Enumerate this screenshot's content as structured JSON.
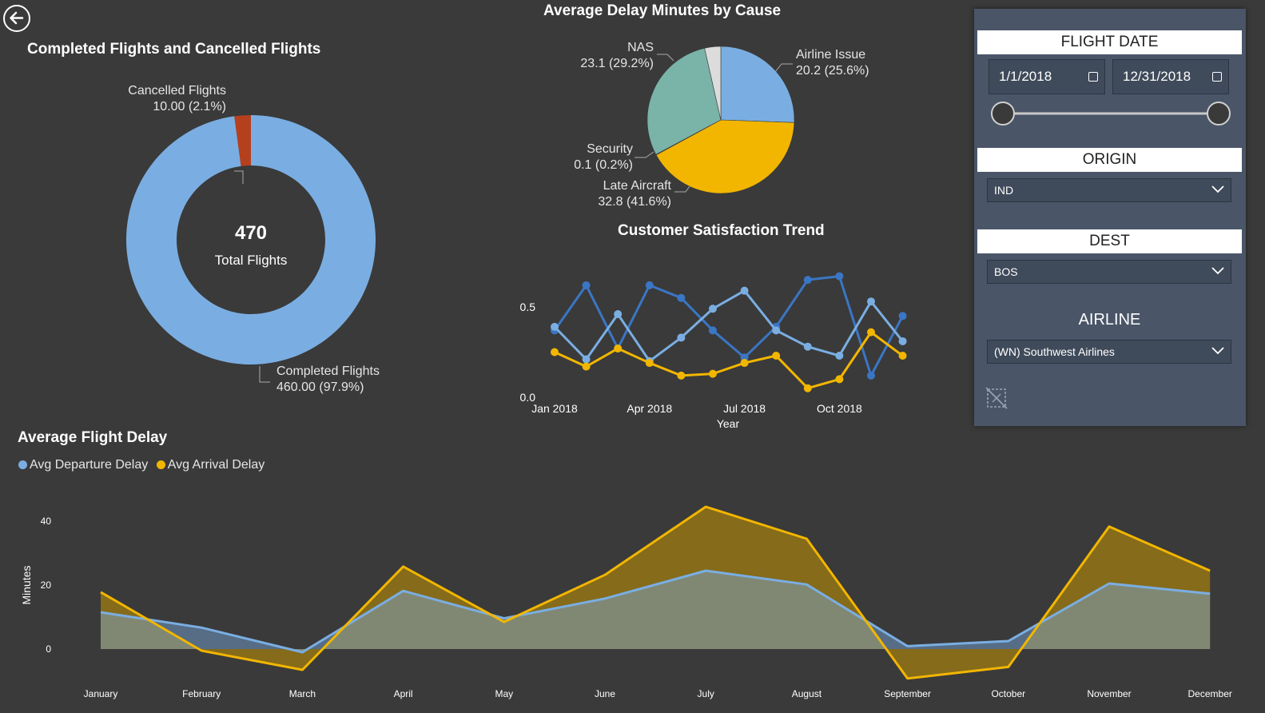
{
  "colors": {
    "background": "#3a3a3a",
    "panel": "#4a5568",
    "light_blue": "#7aaee2",
    "dark_blue": "#3a76c4",
    "yellow": "#f2b600",
    "rust": "#b5401e",
    "teal": "#7ab3a8",
    "light_gray": "#dcdcdc"
  },
  "donut": {
    "title": "Completed Flights and Cancelled Flights",
    "center_value": "470",
    "center_label": "Total Flights",
    "label_cancelled_name": "Cancelled Flights",
    "label_cancelled_value": "10.00 (2.1%)",
    "label_completed_name": "Completed Flights",
    "label_completed_value": "460.00 (97.9%)"
  },
  "pie": {
    "title": "Average Delay Minutes by Cause",
    "label_nas_name": "NAS",
    "label_nas_value": "23.1 (29.2%)",
    "label_airline_name": "Airline Issue",
    "label_airline_value": "20.2 (25.6%)",
    "label_security_name": "Security",
    "label_security_value": "0.1 (0.2%)",
    "label_late_name": "Late Aircraft",
    "label_late_value": "32.8 (41.6%)"
  },
  "satisfaction": {
    "title": "Customer Satisfaction Trend",
    "xlabel": "Year"
  },
  "delay": {
    "title": "Average Flight Delay",
    "ylabel": "Minutes",
    "legend_departure": "Avg Departure Delay",
    "legend_arrival": "Avg Arrival Delay"
  },
  "filters": {
    "flight_date_title": "FLIGHT DATE",
    "date_start": "1/1/2018",
    "date_end": "12/31/2018",
    "origin_title": "ORIGIN",
    "origin_value": "IND",
    "dest_title": "DEST",
    "dest_value": "BOS",
    "airline_title": "AIRLINE",
    "airline_value": "(WN) Southwest Airlines"
  },
  "chart_data": [
    {
      "type": "pie",
      "subtype": "donut",
      "title": "Completed Flights and Cancelled Flights",
      "categories": [
        "Completed Flights",
        "Cancelled Flights"
      ],
      "values": [
        460,
        10
      ],
      "colors": [
        "#7aaee2",
        "#b5401e"
      ]
    },
    {
      "type": "pie",
      "title": "Average Delay Minutes by Cause",
      "categories": [
        "Airline Issue",
        "Late Aircraft",
        "Security",
        "NAS",
        ""
      ],
      "values": [
        20.2,
        32.8,
        0.1,
        23.1,
        2.8
      ],
      "colors": [
        "#7aaee2",
        "#f2b600",
        "#3f6f8f",
        "#7ab3a8",
        "#dcdcdc"
      ]
    },
    {
      "type": "line",
      "title": "Customer Satisfaction Trend",
      "xlabel": "Year",
      "ylabel": "",
      "x_ticks": [
        "Jan 2018",
        "Apr 2018",
        "Jul 2018",
        "Oct 2018"
      ],
      "y_ticks": [
        0.0,
        0.5
      ],
      "ylim": [
        0,
        0.68
      ],
      "x": [
        "2018-01-01",
        "2018-01-15",
        "2018-02-01",
        "2018-02-15",
        "2018-03-01",
        "2018-03-15",
        "2018-04-01",
        "2018-04-15",
        "2018-05-01",
        "2018-05-15",
        "2018-06-01",
        "2018-06-15",
        "2018-07-01",
        "2018-07-15",
        "2018-08-01",
        "2018-08-15",
        "2018-09-01",
        "2018-09-15",
        "2018-10-01",
        "2018-10-15",
        "2018-11-01",
        "2018-11-15"
      ],
      "series": [
        {
          "color": "#3a76c4",
          "values": [
            0.37,
            null,
            0.62,
            null,
            0.27,
            null,
            0.62,
            null,
            0.55,
            null,
            0.37,
            null,
            0.22,
            null,
            0.39,
            null,
            0.65,
            null,
            0.67,
            null,
            0.12,
            null,
            0.45
          ]
        },
        {
          "color": "#7aaee2",
          "values": [
            0.39,
            null,
            0.21,
            null,
            0.46,
            null,
            0.2,
            null,
            0.33,
            null,
            0.49,
            null,
            0.59,
            null,
            0.37,
            null,
            0.28,
            null,
            0.23,
            null,
            0.53,
            null,
            0.31
          ]
        },
        {
          "color": "#f2b600",
          "values": [
            0.25,
            null,
            0.17,
            null,
            0.27,
            null,
            0.19,
            null,
            0.12,
            null,
            0.13,
            null,
            0.19,
            null,
            0.23,
            null,
            0.05,
            null,
            0.1,
            null,
            0.36,
            null,
            0.23
          ]
        }
      ]
    },
    {
      "type": "area",
      "title": "Average Flight Delay",
      "xlabel": "",
      "ylabel": "Minutes",
      "categories": [
        "January",
        "February",
        "March",
        "April",
        "May",
        "June",
        "July",
        "August",
        "September",
        "October",
        "November",
        "December"
      ],
      "y_ticks": [
        0,
        20,
        40
      ],
      "ylim": [
        -14,
        46
      ],
      "series": [
        {
          "name": "Avg Departure Delay",
          "color": "#7aaee2",
          "values": [
            11.5,
            6.7,
            -1.0,
            18.2,
            9.6,
            15.8,
            24.5,
            20.2,
            0.9,
            2.5,
            20.5,
            17.3
          ]
        },
        {
          "name": "Avg Arrival Delay",
          "color": "#f2b600",
          "values": [
            17.8,
            -0.5,
            -6.5,
            25.8,
            8.5,
            23.2,
            44.5,
            34.5,
            -9.2,
            -5.6,
            38.3,
            24.5
          ]
        }
      ],
      "legend": "top-left"
    }
  ]
}
